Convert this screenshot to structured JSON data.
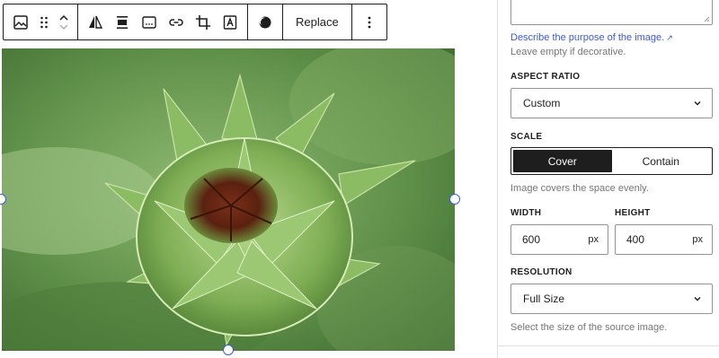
{
  "toolbar": {
    "replace_label": "Replace",
    "icons": [
      "image-icon",
      "drag-handle-icon",
      "move-up-icon",
      "move-down-icon",
      "duotone-icon",
      "align-icon",
      "alt-text-icon",
      "link-icon",
      "crop-icon",
      "text-overlay-icon",
      "apply-filter-icon",
      "more-options-icon"
    ]
  },
  "settings": {
    "describe_link": "Describe the purpose of the image.",
    "describe_help": "Leave empty if decorative.",
    "aspect_ratio": {
      "label": "ASPECT RATIO",
      "value": "Custom"
    },
    "scale": {
      "label": "SCALE",
      "options": [
        "Cover",
        "Contain"
      ],
      "selected": "Cover",
      "help": "Image covers the space evenly."
    },
    "width": {
      "label": "WIDTH",
      "value": "600",
      "unit": "px"
    },
    "height": {
      "label": "HEIGHT",
      "value": "400",
      "unit": "px"
    },
    "resolution": {
      "label": "RESOLUTION",
      "value": "Full Size",
      "help": "Select the size of the source image."
    }
  },
  "colors": {
    "accent": "#3858e9",
    "dark": "#1e1e1e",
    "help_text": "#757575",
    "border": "#949494"
  }
}
